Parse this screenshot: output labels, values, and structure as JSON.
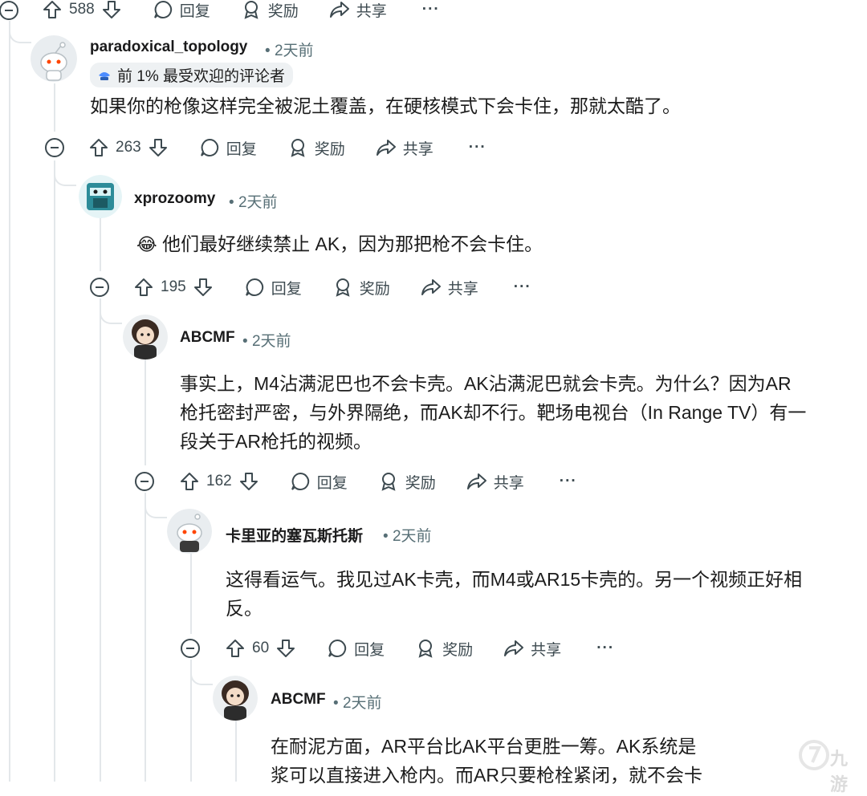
{
  "colors": {
    "text": "#1c1c1c",
    "meta": "#576f76",
    "thread": "#e3e7ea",
    "accent": "#4c8cff"
  },
  "top_actions": {
    "votes": "588",
    "reply": "回复",
    "award": "奖励",
    "share": "共享",
    "more": "···"
  },
  "comments": [
    {
      "author": "paradoxical_topology",
      "time": "2天前",
      "flair": "前 1% 最受欢迎的评论者",
      "body": "如果你的枪像这样完全被泥土覆盖，在硬核模式下会卡住，那就太酷了。",
      "votes": "263",
      "reply": "回复",
      "award": "奖励",
      "share": "共享",
      "more": "···"
    },
    {
      "author": "xprozoomy",
      "time": "2天前",
      "emoji": "😂",
      "body": "他们最好继续禁止 AK，因为那把枪不会卡住。",
      "votes": "195",
      "reply": "回复",
      "award": "奖励",
      "share": "共享",
      "more": "···"
    },
    {
      "author": "ABCMF",
      "time": "2天前",
      "body_lines": [
        "事实上，M4沾满泥巴也不会卡壳。AK沾满泥巴就会卡壳。为什么？因为AR",
        "枪托密封严密，与外界隔绝，而AK却不行。靶场电视台（In Range TV）有一",
        "段关于AR枪托的视频。"
      ],
      "votes": "162",
      "reply": "回复",
      "award": "奖励",
      "share": "共享",
      "more": "···"
    },
    {
      "author": "卡里亚的塞瓦斯托斯",
      "time": "2天前",
      "body_lines": [
        "这得看运气。我见过AK卡壳，而M4或AR15卡壳的。另一个视频正好相",
        "反。"
      ],
      "votes": "60",
      "reply": "回复",
      "award": "奖励",
      "share": "共享",
      "more": "···"
    },
    {
      "author": "ABCMF",
      "time": "2天前",
      "body_lines": [
        "在耐泥方面，AR平台比AK平台更胜一筹。AK系统是",
        "浆可以直接进入枪内。而AR只要枪栓紧闭，就不会卡"
      ]
    }
  ],
  "watermark": {
    "text": "九游"
  }
}
